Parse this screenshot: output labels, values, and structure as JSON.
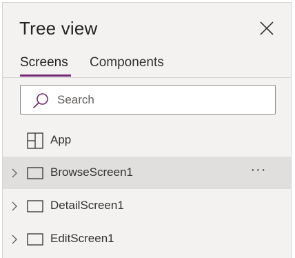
{
  "panel": {
    "title": "Tree view",
    "close_icon": "close-icon"
  },
  "tabs": [
    {
      "label": "Screens",
      "active": true
    },
    {
      "label": "Components",
      "active": false
    }
  ],
  "search": {
    "placeholder": "Search",
    "value": "",
    "icon": "search-icon"
  },
  "tree": {
    "items": [
      {
        "label": "App",
        "icon": "app-grid-icon",
        "expandable": false,
        "selected": false
      },
      {
        "label": "BrowseScreen1",
        "icon": "screen-icon",
        "expandable": true,
        "selected": true,
        "more": "···"
      },
      {
        "label": "DetailScreen1",
        "icon": "screen-icon",
        "expandable": true,
        "selected": false
      },
      {
        "label": "EditScreen1",
        "icon": "screen-icon",
        "expandable": true,
        "selected": false
      }
    ]
  },
  "colors": {
    "accent": "#742774",
    "panel_bg": "#f3f2f1",
    "selected_bg": "#e1dfdd",
    "text": "#323130"
  }
}
